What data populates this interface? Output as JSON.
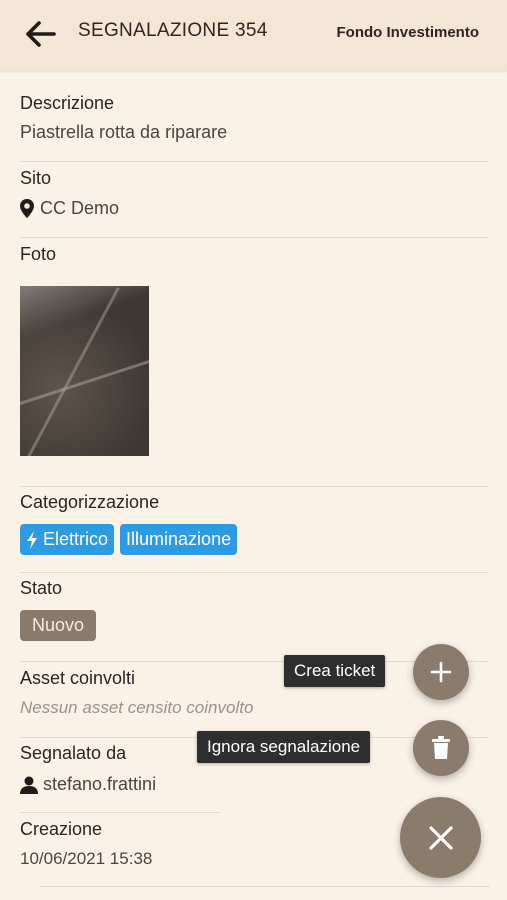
{
  "header": {
    "title": "SEGNALAZIONE 354",
    "right_label": "Fondo Investimento"
  },
  "descrizione": {
    "label": "Descrizione",
    "value": "Piastrella rotta da riparare"
  },
  "sito": {
    "label": "Sito",
    "value": "CC Demo",
    "icon": "map-marker-icon"
  },
  "foto": {
    "label": "Foto"
  },
  "categorizzazione": {
    "label": "Categorizzazione",
    "tags": [
      {
        "label": "Elettrico",
        "icon": "lightning-icon"
      },
      {
        "label": "Illuminazione"
      }
    ],
    "tag_color": "#2d9be3"
  },
  "stato": {
    "label": "Stato",
    "value": "Nuovo",
    "color": "#8a7a6b"
  },
  "asset": {
    "label": "Asset coinvolti",
    "value": "Nessun asset censito coinvolto"
  },
  "segnalato": {
    "label": "Segnalato da",
    "value": "stefano.frattini",
    "icon": "user-icon"
  },
  "creazione": {
    "label": "Creazione",
    "value": "10/06/2021 15:38"
  },
  "fab_menu": {
    "create_ticket_label": "Crea ticket",
    "ignore_label": "Ignora segnalazione",
    "accent": "#8b7b6d"
  }
}
